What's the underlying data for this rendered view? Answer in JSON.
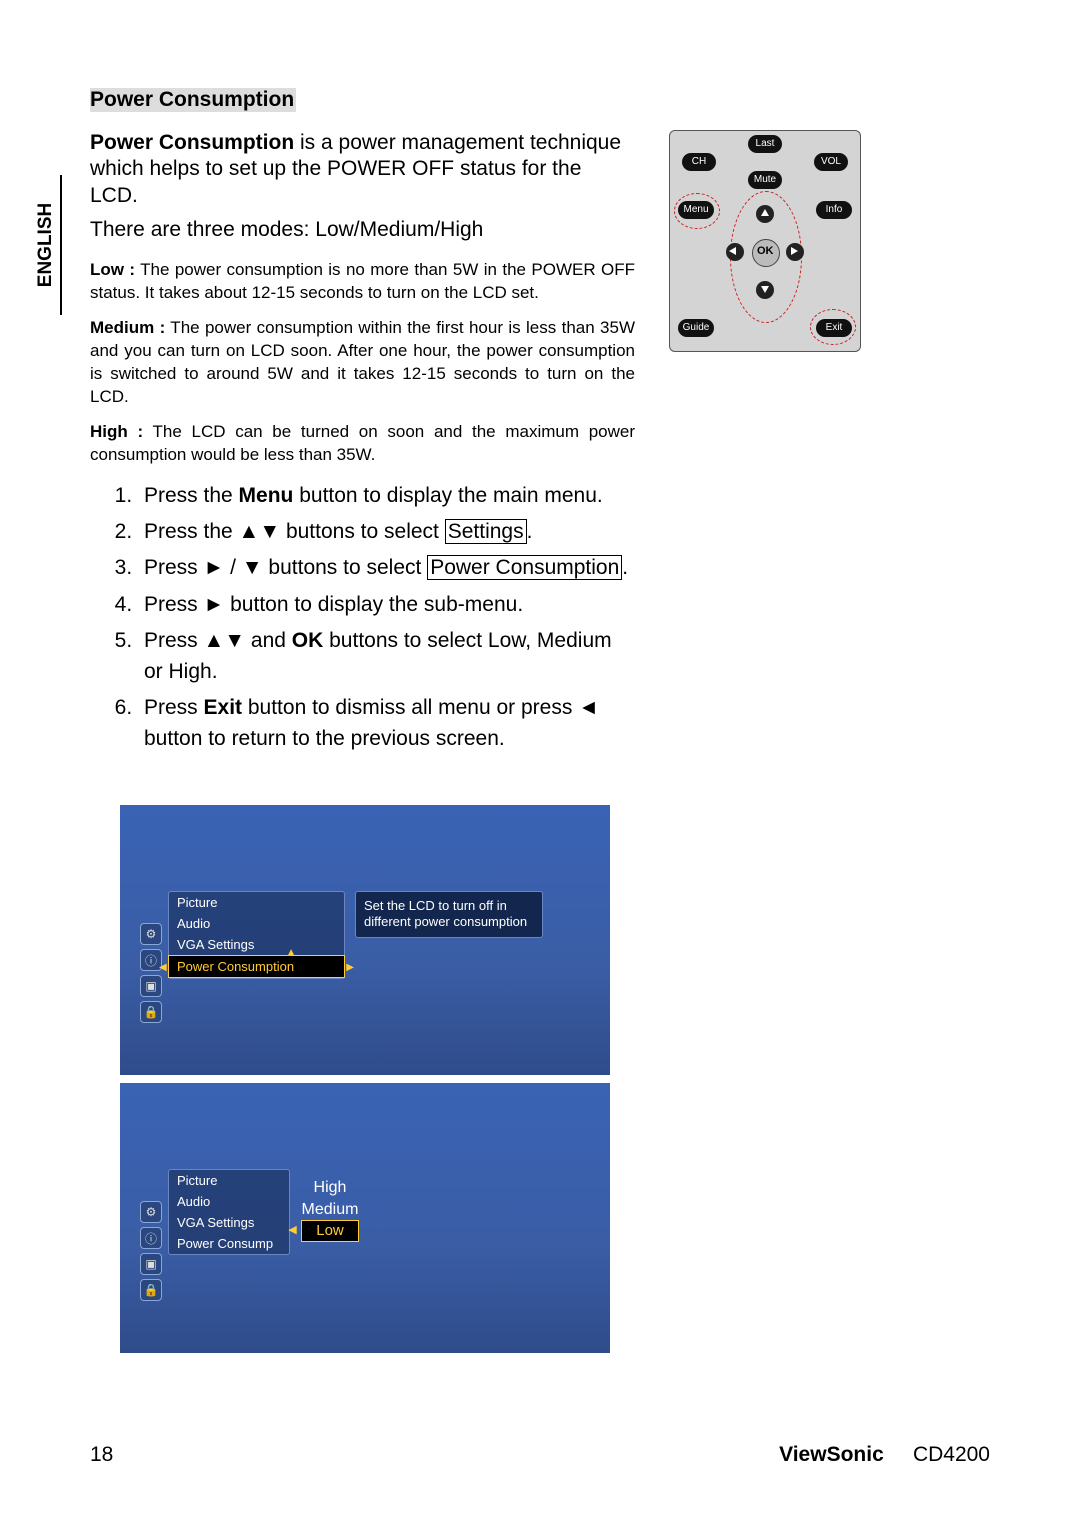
{
  "language_tab": "ENGLISH",
  "title": "Power Consumption",
  "intro_bold": "Power Consumption",
  "intro_rest": " is a power management technique which helps to set up the POWER OFF status for the LCD.",
  "intro_line2": "There are three modes: Low/Medium/High",
  "low_label": "Low :",
  "low_text": " The power consumption is no more than 5W in the POWER OFF status. It takes about 12-15 seconds to turn on the LCD set.",
  "med_label": "Medium :",
  "med_text": " The power consumption within the first hour is less than 35W and you can turn on LCD soon. After one hour, the power consumption is switched to around 5W and it takes 12-15 seconds to turn on the LCD.",
  "high_label": "High :",
  "high_text": " The LCD can be turned on soon and the maximum power consumption would be less than 35W.",
  "steps": {
    "s1a": "Press the ",
    "s1b": "Menu",
    "s1c": " button to display the main menu.",
    "s2a": "Press the ▲▼ buttons to select ",
    "s2_box": "Settings",
    "s2c": ".",
    "s3a": "Press ► / ▼ buttons to select ",
    "s3_box": "Power Consumption",
    "s3c": ".",
    "s4": "Press ► button to display the sub-menu.",
    "s5a": "Press ▲▼ and ",
    "s5b": "OK",
    "s5c": " buttons to select Low, Medium or High.",
    "s6a": "Press ",
    "s6b": "Exit",
    "s6c": " button to dismiss all menu or press ◄ button to return to the previous screen."
  },
  "remote": {
    "last": "Last",
    "ch": "CH",
    "vol": "VOL",
    "mute": "Mute",
    "menu": "Menu",
    "info": "Info",
    "guide": "Guide",
    "exit": "Exit",
    "ok": "OK"
  },
  "osd1": {
    "menu": [
      "Picture",
      "Audio",
      "VGA Settings",
      "Power Consumption"
    ],
    "tooltip": "Set the LCD to turn off in different power consumption"
  },
  "osd2": {
    "menu": [
      "Picture",
      "Audio",
      "VGA Settings",
      "Power Consump"
    ],
    "options": [
      "High",
      "Medium",
      "Low"
    ]
  },
  "footer": {
    "page": "18",
    "brand": "ViewSonic",
    "model": "CD4200"
  }
}
